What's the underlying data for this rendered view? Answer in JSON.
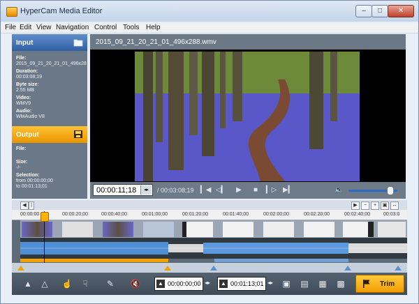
{
  "window": {
    "title": "HyperCam Media Editor",
    "minimize": "–",
    "restore": "□",
    "close": "✕"
  },
  "menu": [
    "File",
    "Edit",
    "View",
    "Navigation",
    "Control",
    "Tools",
    "Help"
  ],
  "input": {
    "title": "Input",
    "file_label": "File:",
    "file_value": "2015_09_21_20_21_01_496x28",
    "duration_label": "Duration:",
    "duration_value": "00:03:08;19",
    "size_label": "Byte size:",
    "size_value": "2.55 MB",
    "video_label": "Video:",
    "video_value": "WMV9",
    "audio_label": "Audio:",
    "audio_value": "WMAudio V8"
  },
  "output": {
    "title": "Output",
    "file_label": "File:",
    "file_value": "",
    "size_label": "Size:",
    "size_value": "-/-",
    "selection_label": "Selection:",
    "from_label": "from",
    "from_value": "00:00:00;00",
    "to_label": "to",
    "to_value": "00:01:13;01"
  },
  "player": {
    "filename": "2015_09_21_20_21_01_496x288.wmv",
    "timecode": "00:00:11;18",
    "duration": "/ 00:03:08;19",
    "volume": 0.85
  },
  "timeline": {
    "ticks": [
      "00:00:00",
      "00:00:20;00",
      "00:00:40;00",
      "00:01:00;00",
      "00:01:20;00",
      "00:01:40;00",
      "00:02:00;00",
      "00:02:20;00",
      "00:02:40;00",
      "00:03:0"
    ]
  },
  "bottom": {
    "start": "00:00:00;00",
    "end": "00:01:13;01",
    "trim_label": "Trim"
  },
  "colors": {
    "accent_orange": "#f4a000",
    "accent_blue": "#2f5fa3"
  }
}
